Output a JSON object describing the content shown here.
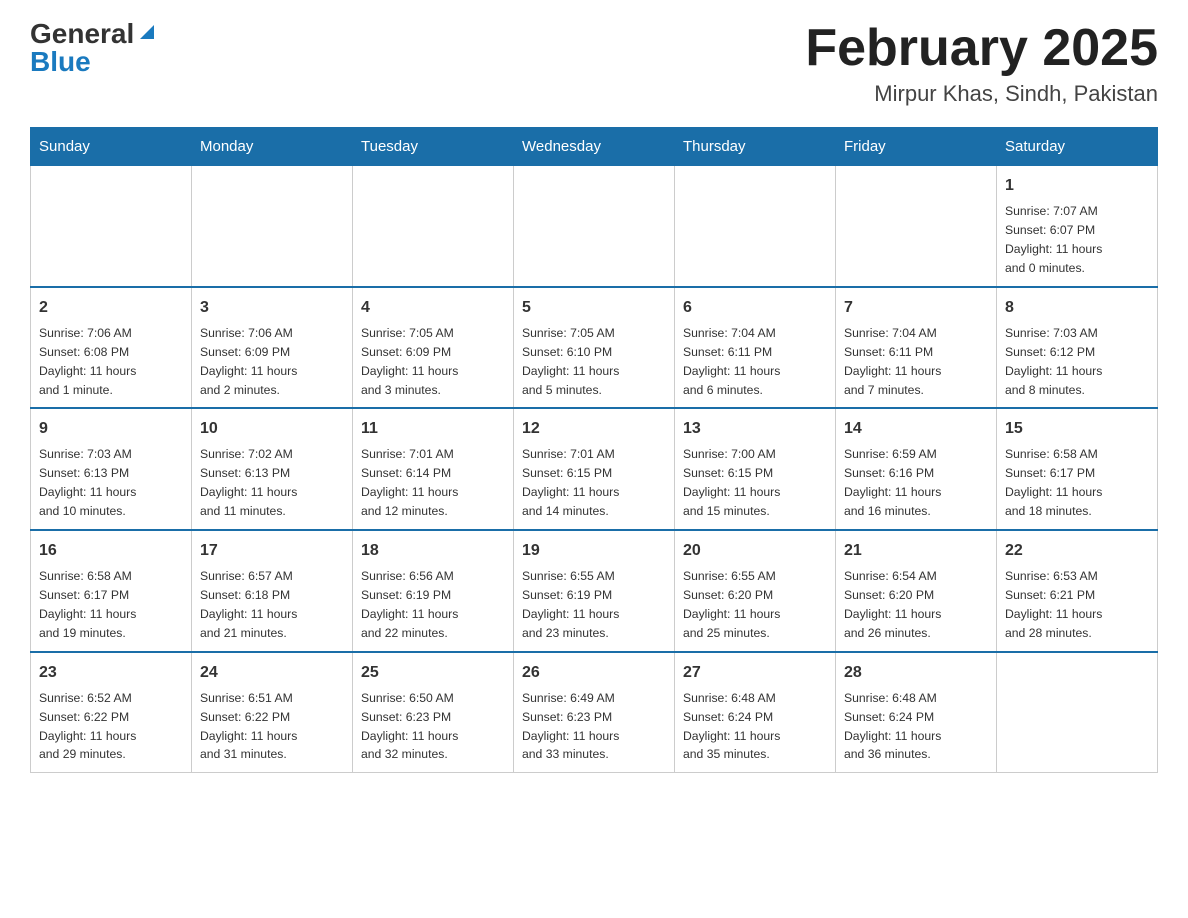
{
  "logo": {
    "general": "General",
    "blue": "Blue"
  },
  "title": {
    "month": "February 2025",
    "location": "Mirpur Khas, Sindh, Pakistan"
  },
  "headers": [
    "Sunday",
    "Monday",
    "Tuesday",
    "Wednesday",
    "Thursday",
    "Friday",
    "Saturday"
  ],
  "weeks": [
    [
      {
        "day": "",
        "info": ""
      },
      {
        "day": "",
        "info": ""
      },
      {
        "day": "",
        "info": ""
      },
      {
        "day": "",
        "info": ""
      },
      {
        "day": "",
        "info": ""
      },
      {
        "day": "",
        "info": ""
      },
      {
        "day": "1",
        "info": "Sunrise: 7:07 AM\nSunset: 6:07 PM\nDaylight: 11 hours\nand 0 minutes."
      }
    ],
    [
      {
        "day": "2",
        "info": "Sunrise: 7:06 AM\nSunset: 6:08 PM\nDaylight: 11 hours\nand 1 minute."
      },
      {
        "day": "3",
        "info": "Sunrise: 7:06 AM\nSunset: 6:09 PM\nDaylight: 11 hours\nand 2 minutes."
      },
      {
        "day": "4",
        "info": "Sunrise: 7:05 AM\nSunset: 6:09 PM\nDaylight: 11 hours\nand 3 minutes."
      },
      {
        "day": "5",
        "info": "Sunrise: 7:05 AM\nSunset: 6:10 PM\nDaylight: 11 hours\nand 5 minutes."
      },
      {
        "day": "6",
        "info": "Sunrise: 7:04 AM\nSunset: 6:11 PM\nDaylight: 11 hours\nand 6 minutes."
      },
      {
        "day": "7",
        "info": "Sunrise: 7:04 AM\nSunset: 6:11 PM\nDaylight: 11 hours\nand 7 minutes."
      },
      {
        "day": "8",
        "info": "Sunrise: 7:03 AM\nSunset: 6:12 PM\nDaylight: 11 hours\nand 8 minutes."
      }
    ],
    [
      {
        "day": "9",
        "info": "Sunrise: 7:03 AM\nSunset: 6:13 PM\nDaylight: 11 hours\nand 10 minutes."
      },
      {
        "day": "10",
        "info": "Sunrise: 7:02 AM\nSunset: 6:13 PM\nDaylight: 11 hours\nand 11 minutes."
      },
      {
        "day": "11",
        "info": "Sunrise: 7:01 AM\nSunset: 6:14 PM\nDaylight: 11 hours\nand 12 minutes."
      },
      {
        "day": "12",
        "info": "Sunrise: 7:01 AM\nSunset: 6:15 PM\nDaylight: 11 hours\nand 14 minutes."
      },
      {
        "day": "13",
        "info": "Sunrise: 7:00 AM\nSunset: 6:15 PM\nDaylight: 11 hours\nand 15 minutes."
      },
      {
        "day": "14",
        "info": "Sunrise: 6:59 AM\nSunset: 6:16 PM\nDaylight: 11 hours\nand 16 minutes."
      },
      {
        "day": "15",
        "info": "Sunrise: 6:58 AM\nSunset: 6:17 PM\nDaylight: 11 hours\nand 18 minutes."
      }
    ],
    [
      {
        "day": "16",
        "info": "Sunrise: 6:58 AM\nSunset: 6:17 PM\nDaylight: 11 hours\nand 19 minutes."
      },
      {
        "day": "17",
        "info": "Sunrise: 6:57 AM\nSunset: 6:18 PM\nDaylight: 11 hours\nand 21 minutes."
      },
      {
        "day": "18",
        "info": "Sunrise: 6:56 AM\nSunset: 6:19 PM\nDaylight: 11 hours\nand 22 minutes."
      },
      {
        "day": "19",
        "info": "Sunrise: 6:55 AM\nSunset: 6:19 PM\nDaylight: 11 hours\nand 23 minutes."
      },
      {
        "day": "20",
        "info": "Sunrise: 6:55 AM\nSunset: 6:20 PM\nDaylight: 11 hours\nand 25 minutes."
      },
      {
        "day": "21",
        "info": "Sunrise: 6:54 AM\nSunset: 6:20 PM\nDaylight: 11 hours\nand 26 minutes."
      },
      {
        "day": "22",
        "info": "Sunrise: 6:53 AM\nSunset: 6:21 PM\nDaylight: 11 hours\nand 28 minutes."
      }
    ],
    [
      {
        "day": "23",
        "info": "Sunrise: 6:52 AM\nSunset: 6:22 PM\nDaylight: 11 hours\nand 29 minutes."
      },
      {
        "day": "24",
        "info": "Sunrise: 6:51 AM\nSunset: 6:22 PM\nDaylight: 11 hours\nand 31 minutes."
      },
      {
        "day": "25",
        "info": "Sunrise: 6:50 AM\nSunset: 6:23 PM\nDaylight: 11 hours\nand 32 minutes."
      },
      {
        "day": "26",
        "info": "Sunrise: 6:49 AM\nSunset: 6:23 PM\nDaylight: 11 hours\nand 33 minutes."
      },
      {
        "day": "27",
        "info": "Sunrise: 6:48 AM\nSunset: 6:24 PM\nDaylight: 11 hours\nand 35 minutes."
      },
      {
        "day": "28",
        "info": "Sunrise: 6:48 AM\nSunset: 6:24 PM\nDaylight: 11 hours\nand 36 minutes."
      },
      {
        "day": "",
        "info": ""
      }
    ]
  ]
}
